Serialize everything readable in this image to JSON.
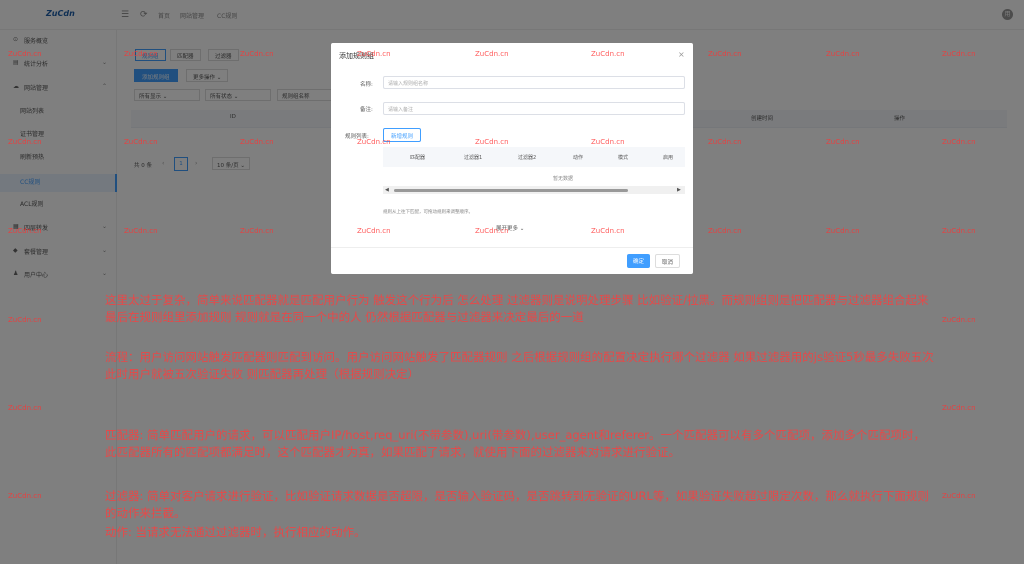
{
  "topbar": {
    "logo": "ZuCdn",
    "crumbs": [
      "首页",
      "网站管理",
      "CC规则"
    ],
    "avatar": "用"
  },
  "sidebar": {
    "items": [
      {
        "icon": "⊙",
        "label": "服务概览"
      },
      {
        "icon": "▤",
        "label": "统计分析",
        "arrow": "⌄"
      },
      {
        "icon": "☁",
        "label": "网站管理",
        "arrow": "⌃"
      },
      {
        "label": "网站列表"
      },
      {
        "label": "证书管理"
      },
      {
        "label": "刷新预热"
      },
      {
        "label": "CC规则"
      },
      {
        "label": "ACL规则"
      },
      {
        "icon": "▦",
        "label": "四层转发",
        "arrow": "⌄"
      },
      {
        "icon": "◆",
        "label": "套餐管理",
        "arrow": "⌄"
      },
      {
        "icon": "♟",
        "label": "用户中心",
        "arrow": "⌄"
      }
    ]
  },
  "main": {
    "tabs": [
      "规则组",
      "匹配器",
      "过滤器"
    ],
    "add_group": "添加规则组",
    "more_ops": "更多操作 ⌄",
    "filters": [
      "所有显示 ⌄",
      "所有状态 ⌄",
      "规则组名称"
    ],
    "table_headers": {
      "id": "ID",
      "created": "创建时间",
      "actions": "操作"
    },
    "pager": {
      "total": "共 0 条",
      "prev": "‹",
      "page": "1",
      "next": "›",
      "per_page": "10 条/页 ⌄"
    }
  },
  "modal": {
    "title": "添加规则组",
    "close": "×",
    "name_label": "名称:",
    "name_placeholder": "请输入规则组名称",
    "remark_label": "备注:",
    "remark_placeholder": "请输入备注",
    "rules_label": "规则列表:",
    "add_rule": "新增规则",
    "rule_headers": [
      "匹配器",
      "过滤器1",
      "过滤器2",
      "动作",
      "模式",
      "启用"
    ],
    "no_data": "暂无数据",
    "scroll_left": "◀",
    "scroll_right": "▶",
    "hint": "规则从上往下匹配，可拖动规则来调整顺序。",
    "expand": "展开更多 ⌄",
    "confirm": "确定",
    "cancel": "取消"
  },
  "watermark": "ZuCdn.cn",
  "help": {
    "p1": "这里太过于复杂，简单来说匹配器就是匹配用户行为 触发这个行为后 怎么处理 过滤器则是说明处理步骤 比如验证/拉黑。而规则组则是把匹配器与过滤器组合起来 最后在规则组里添加规则 规则就是在同一个中的人 仍然根据匹配器与过滤器来决定最后的一道",
    "p2": "流程：用户访问网站触发匹配器则匹配到访问。用户访问网站触发了匹配器规则 之后根据规则组的配置决定执行哪个过滤器 如果过滤器用的js验证5秒最多失败五次 此时用户就被五次验证失败 则匹配器再处理（根据规则决定）",
    "p3": "匹配器: 简单匹配用户的请求，可以匹配用户IP/host,req_uri(不带参数),uri(带参数),user_agent和referer。一个匹配器可以有多个匹配项，添加多个匹配项时，此匹配器所有的匹配项都满足时，这个匹配器才为真，如果匹配了请求，就使用下面的过滤器来对请求进行验证。",
    "p4": "过滤器: 简单对客户请求进行验证，比如验证请求数据是否超限，是否输入验证码，是否跳转到无验证的URL等，如果验证失败超过限定次数，那么就执行下面规则的动作来拦截。",
    "p5": "动作: 当请求无法通过过滤器时，执行相应的动作。"
  }
}
